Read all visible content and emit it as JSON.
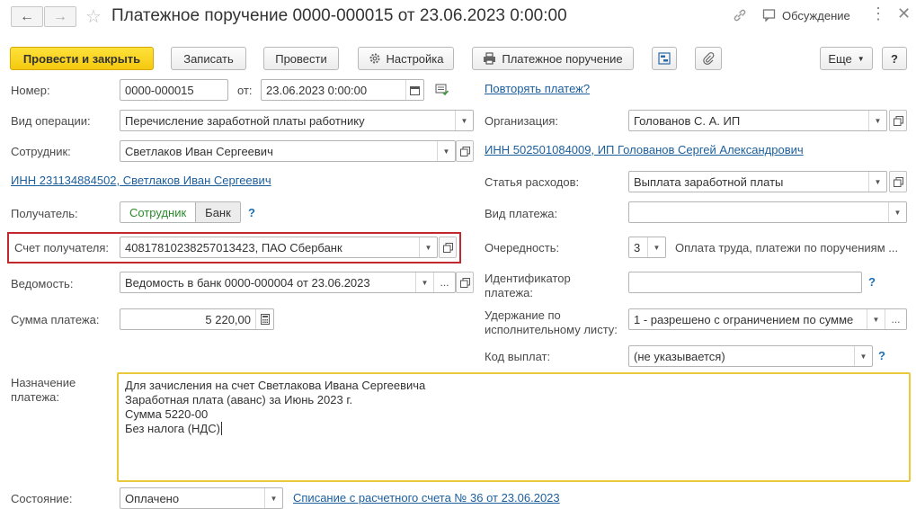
{
  "header": {
    "title": "Платежное поручение 0000-000015 от 23.06.2023 0:00:00",
    "discussion": "Обсуждение"
  },
  "toolbar": {
    "post_close": "Провести и закрыть",
    "save": "Записать",
    "post": "Провести",
    "settings": "Настройка",
    "print_order": "Платежное поручение",
    "more": "Еще",
    "help": "?"
  },
  "form": {
    "number_label": "Номер:",
    "number_value": "0000-000015",
    "from_label": "от:",
    "date_value": "23.06.2023  0:00:00",
    "repeat_link": "Повторять платеж?",
    "op_type_label": "Вид операции:",
    "op_type_value": "Перечисление заработной платы работнику",
    "org_label": "Организация:",
    "org_value": "Голованов С. А. ИП",
    "employee_label": "Сотрудник:",
    "employee_value": "Светлаков Иван Сергеевич",
    "org_inn_link": "ИНН 502501084009, ИП Голованов Сергей Александрович",
    "employee_inn_link": "ИНН 231134884502, Светлаков Иван Сергеевич",
    "expense_label": "Статья расходов:",
    "expense_value": "Выплата заработной платы",
    "recipient_label": "Получатель:",
    "recipient_employee": "Сотрудник",
    "recipient_bank": "Банк",
    "payment_type_label": "Вид платежа:",
    "payment_type_value": "",
    "account_label": "Счет получателя:",
    "account_value": "40817810238257013423, ПАО Сбербанк",
    "priority_label": "Очередность:",
    "priority_value": "3",
    "priority_text": "Оплата труда, платежи по поручениям ...",
    "statement_label": "Ведомость:",
    "statement_value": "Ведомость в банк 0000-000004 от 23.06.2023",
    "payment_id_label_1": "Идентификатор",
    "payment_id_label_2": "платежа:",
    "payment_id_value": "",
    "amount_label": "Сумма платежа:",
    "amount_value": "5 220,00",
    "deduction_label_1": "Удержание по",
    "deduction_label_2": "исполнительному листу:",
    "deduction_value": "1 - разрешено с ограничением по сумме",
    "income_code_label": "Код выплат:",
    "income_code_value": "(не указывается)",
    "purpose_label_1": "Назначение",
    "purpose_label_2": "платежа:",
    "purpose_lines": [
      "Для зачисления на счет Светлакова Ивана Сергеевича",
      "Заработная плата (аванс) за Июнь 2023 г.",
      "Сумма 5220-00",
      "Без налога (НДС)"
    ],
    "state_label": "Состояние:",
    "state_value": "Оплачено",
    "writeoff_link": "Списание с расчетного счета № 36 от 23.06.2023"
  },
  "colors": {
    "primary_button": "#f5c90f",
    "highlight_border": "#c0292e",
    "purpose_border": "#e8c93c",
    "link": "#1b5e9c"
  }
}
